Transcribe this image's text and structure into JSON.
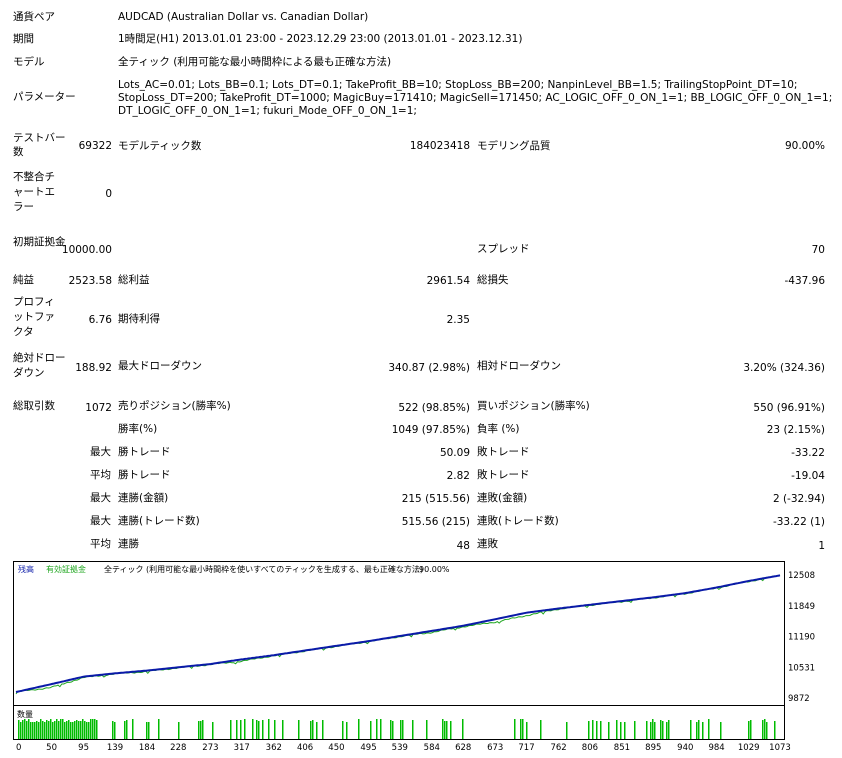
{
  "report": {
    "symbol_label": "通貨ペア",
    "symbol_value": "AUDCAD (Australian Dollar vs. Canadian Dollar)",
    "period_label": "期間",
    "period_value": "1時間足(H1) 2013.01.01 23:00 - 2023.12.29 23:00 (2013.01.01 - 2023.12.31)",
    "model_label": "モデル",
    "model_value": "全ティック (利用可能な最小時間枠による最も正確な方法)",
    "params_label": "パラメーター",
    "params_lines": [
      "Lots_AC=0.01; Lots_BB=0.1; Lots_DT=0.1; TakeProfit_BB=10; StopLoss_BB=200; NanpinLevel_BB=1.5; TrailingStopPoint_DT=10;",
      "StopLoss_DT=200; TakeProfit_DT=1000; MagicBuy=171410; MagicSell=171450; AC_LOGIC_OFF_0_ON_1=1; BB_LOGIC_OFF_0_ON_1=1;",
      "DT_LOGIC_OFF_0_ON_1=1; fukuri_Mode_OFF_0_ON_1=1;"
    ]
  },
  "stats": {
    "bars_label": "テストバー数",
    "bars_value": "69322",
    "ticks_label": "モデルティック数",
    "ticks_value": "184023418",
    "quality_label": "モデリング品質",
    "quality_value": "90.00%",
    "mismatch_label": "不整合チャートエラー",
    "mismatch_value": "0",
    "deposit_label": "初期証拠金",
    "deposit_value": "10000.00",
    "spread_label": "スプレッド",
    "spread_value": "70",
    "net_label": "純益",
    "net_value": "2523.58",
    "gross_profit_label": "総利益",
    "gross_profit_value": "2961.54",
    "gross_loss_label": "総損失",
    "gross_loss_value": "-437.96",
    "pf_label": "プロフィットファクタ",
    "pf_value": "6.76",
    "payoff_label": "期待利得",
    "payoff_value": "2.35",
    "abs_dd_label": "絶対ドローダウン",
    "abs_dd_value": "188.92",
    "max_dd_label": "最大ドローダウン",
    "max_dd_value": "340.87 (2.98%)",
    "rel_dd_label": "相対ドローダウン",
    "rel_dd_value": "3.20% (324.36)",
    "trades_label": "総取引数",
    "trades_value": "1072",
    "short_label": "売りポジション(勝率%)",
    "short_value": "522 (98.85%)",
    "long_label": "買いポジション(勝率%)",
    "long_value": "550 (96.91%)",
    "win_pct_label": "勝率(%)",
    "win_pct_value": "1049 (97.85%)",
    "loss_pct_label": "負率 (%)",
    "loss_pct_value": "23 (2.15%)",
    "max_label": "最大",
    "avg_label": "平均",
    "largest_win_label": "勝トレード",
    "largest_win_value": "50.09",
    "largest_loss_label": "敗トレード",
    "largest_loss_value": "-33.22",
    "avg_win_label": "勝トレード",
    "avg_win_value": "2.82",
    "avg_loss_label": "敗トレード",
    "avg_loss_value": "-19.04",
    "max_cons_wins_label": "連勝(金額)",
    "max_cons_wins_value": "215 (515.56)",
    "max_cons_losses_label": "連敗(金額)",
    "max_cons_losses_value": "2 (-32.94)",
    "max_cons_profit_label": "連勝(トレード数)",
    "max_cons_profit_value": "515.56 (215)",
    "max_cons_loss_label": "連敗(トレード数)",
    "max_cons_loss_value": "-33.22 (1)",
    "avg_cons_wins_label": "連勝",
    "avg_cons_wins_value": "48",
    "avg_cons_losses_label": "連敗",
    "avg_cons_losses_value": "1"
  },
  "chart_data": {
    "type": "line",
    "legend": [
      "残高",
      "有効証拠金",
      "全ティック (利用可能な最小時間枠を使いすべてのティックを生成する、最も正確な方法)",
      "90.00%"
    ],
    "colors": {
      "balance": "#0a1aa8",
      "equity": "#1fa61f",
      "volume": "#00bb00"
    },
    "ylim": [
      9872,
      12508
    ],
    "y_ticks": [
      "12508",
      "11849",
      "11190",
      "10531",
      "9872"
    ],
    "x_ticks": [
      "0",
      "50",
      "95",
      "139",
      "184",
      "228",
      "273",
      "317",
      "362",
      "406",
      "450",
      "495",
      "539",
      "584",
      "628",
      "673",
      "717",
      "762",
      "806",
      "851",
      "895",
      "940",
      "984",
      "1029",
      "1073"
    ],
    "x": [
      0,
      50,
      95,
      139,
      184,
      228,
      273,
      317,
      362,
      406,
      450,
      495,
      539,
      584,
      628,
      673,
      717,
      762,
      806,
      851,
      895,
      940,
      984,
      1029,
      1073
    ],
    "series": [
      {
        "name": "残高",
        "values": [
          10000,
          10170,
          10330,
          10400,
          10460,
          10530,
          10600,
          10700,
          10790,
          10890,
          10990,
          11090,
          11200,
          11310,
          11420,
          11560,
          11700,
          11790,
          11870,
          11950,
          12030,
          12120,
          12240,
          12380,
          12500
        ]
      },
      {
        "name": "有効証拠金",
        "values": [
          10000,
          10100,
          10310,
          10390,
          10440,
          10520,
          10590,
          10660,
          10780,
          10880,
          10980,
          11080,
          11190,
          11280,
          11400,
          11500,
          11640,
          11780,
          11860,
          11940,
          12020,
          12110,
          12230,
          12370,
          12500
        ]
      }
    ],
    "volume_label": "数量"
  }
}
